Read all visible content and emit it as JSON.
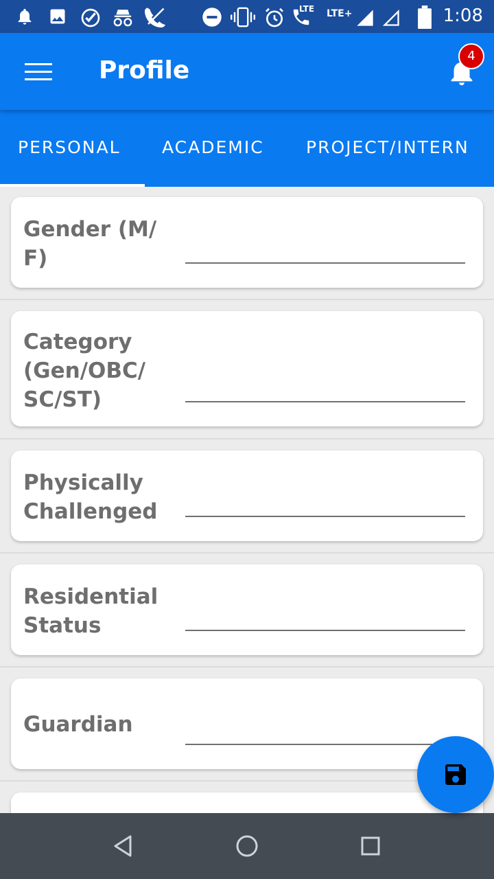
{
  "status_bar": {
    "time": "1:08",
    "lte1": "LTE",
    "lte2": "LTE+"
  },
  "app_bar": {
    "title": "Profile",
    "notification_count": "4"
  },
  "tabs": [
    {
      "label": "PERSONAL"
    },
    {
      "label": "ACADEMIC"
    },
    {
      "label": "PROJECT/INTERN"
    }
  ],
  "form": {
    "fields": [
      {
        "label": "Gender (M/ F)",
        "value": ""
      },
      {
        "label": "Category (Gen/OBC/ SC/ST)",
        "value": ""
      },
      {
        "label": "Physically Challenged",
        "value": ""
      },
      {
        "label": "Residential Status",
        "value": ""
      },
      {
        "label": "Guardian",
        "value": ""
      }
    ]
  },
  "colors": {
    "primary": "#0a7af0",
    "status_bar": "#1a4d9b",
    "badge": "#d80000",
    "nav_bar": "#454b52"
  },
  "icons": {
    "menu": "menu-icon",
    "notification": "bell-icon",
    "save": "floppy-disk-icon",
    "back": "back-triangle-icon",
    "home": "home-circle-icon",
    "recents": "recents-square-icon"
  }
}
